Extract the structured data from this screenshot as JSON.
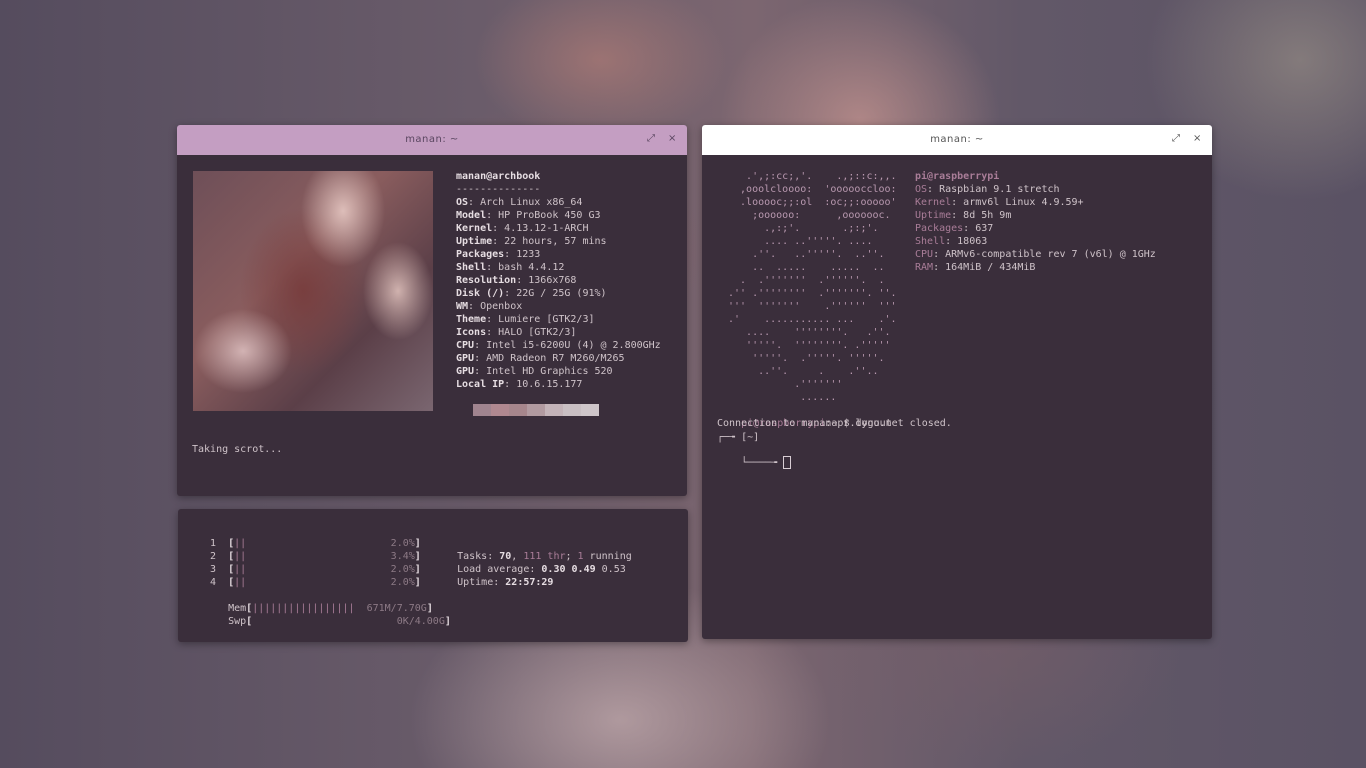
{
  "left_terminal": {
    "title": "manan: ~",
    "maximize_icon": "⤢",
    "close_icon": "×",
    "user_host": "manan@archbook",
    "separator": "--------------",
    "info": [
      {
        "key": "OS",
        "value": "Arch Linux x86_64"
      },
      {
        "key": "Model",
        "value": "HP ProBook 450 G3"
      },
      {
        "key": "Kernel",
        "value": "4.13.12-1-ARCH"
      },
      {
        "key": "Uptime",
        "value": "22 hours, 57 mins"
      },
      {
        "key": "Packages",
        "value": "1233"
      },
      {
        "key": "Shell",
        "value": "bash 4.4.12"
      },
      {
        "key": "Resolution",
        "value": "1366x768"
      },
      {
        "key": "Disk (/)",
        "value": "22G / 25G (91%)"
      },
      {
        "key": "WM",
        "value": "Openbox"
      },
      {
        "key": "Theme",
        "value": "Lumiere [GTK2/3]"
      },
      {
        "key": "Icons",
        "value": "HALO [GTK2/3]"
      },
      {
        "key": "CPU",
        "value": "Intel i5-6200U (4) @ 2.800GHz"
      },
      {
        "key": "GPU",
        "value": "AMD Radeon R7 M260/M265"
      },
      {
        "key": "GPU",
        "value": "Intel HD Graphics 520"
      },
      {
        "key": "Local IP",
        "value": "10.6.15.177"
      }
    ],
    "palette": [
      "#a0848f",
      "#b08890",
      "#a6868c",
      "#b19aa0",
      "#c3b3b8",
      "#c9bfc3",
      "#cfc6ca"
    ],
    "status_line": "Taking scrot..."
  },
  "htop": {
    "cpus": [
      {
        "num": "1",
        "bar": "||",
        "pct": "2.0%"
      },
      {
        "num": "2",
        "bar": "||",
        "pct": "3.4%"
      },
      {
        "num": "3",
        "bar": "||",
        "pct": "2.0%"
      },
      {
        "num": "4",
        "bar": "||",
        "pct": "2.0%"
      }
    ],
    "mem_label": "Mem",
    "mem_bar": "|||||||||||||||||",
    "mem_value": "671M/7.70G",
    "swp_label": "Swp",
    "swp_value": "0K/4.00G",
    "tasks_label": "Tasks:",
    "tasks": "70",
    "threads": "111 thr",
    "running_count": "1",
    "running_label": "running",
    "load_label": "Load average:",
    "load1": "0.30",
    "load5": "0.49",
    "load15": "0.53",
    "uptime_label": "Uptime:",
    "uptime": "22:57:29"
  },
  "right_terminal": {
    "title": "manan: ~",
    "maximize_icon": "⤢",
    "close_icon": "×",
    "logo_lines": [
      "   .',;:cc;,'.    .,;::c:,,.",
      "  ,ooolcloooo:  'oooooccloo:",
      "  .looooc;;:ol  :oc;;:ooooo'",
      "    ;oooooo:      ,ooooooc.",
      "      .,:;'.       .;:;'.",
      "      .... ..'''''. ....",
      "    .''.   ..'''''.  ..''.",
      "    ..  .....    .....  ..",
      "  .  .'''''''  .''''''.  .",
      ".'' .''''''''  .'''''''. ''.",
      "'''  '''''''    .''''''  '''",
      ".'    ........... ...    .'.",
      "   ....    ''''''''.   .''.",
      "   '''''.  ''''''''. .'''''",
      "    '''''.  .'''''. '''''.",
      "     ..''.     .    .''..",
      "           .'''''''",
      "            ......"
    ],
    "user_host": "pi@raspberrypi",
    "info": [
      {
        "key": "OS",
        "value": "Raspbian 9.1 stretch"
      },
      {
        "key": "Kernel",
        "value": "armv6l Linux 4.9.59+"
      },
      {
        "key": "Uptime",
        "value": "8d 5h 9m"
      },
      {
        "key": "Packages",
        "value": "637"
      },
      {
        "key": "Shell",
        "value": "18063"
      },
      {
        "key": "CPU",
        "value": "ARMv6-compatible rev 7 (v6l) @ 1GHz"
      },
      {
        "key": "RAM",
        "value": "164MiB / 434MiB"
      }
    ],
    "prompt_user": "pi@raspberrypi",
    "prompt_path": ":~ $ ",
    "command": "logout",
    "output": "Connection to mananapr.dynu.net closed.",
    "prompt2_top": "┌─╼ [~]",
    "prompt2_bottom": "└────╼ "
  }
}
